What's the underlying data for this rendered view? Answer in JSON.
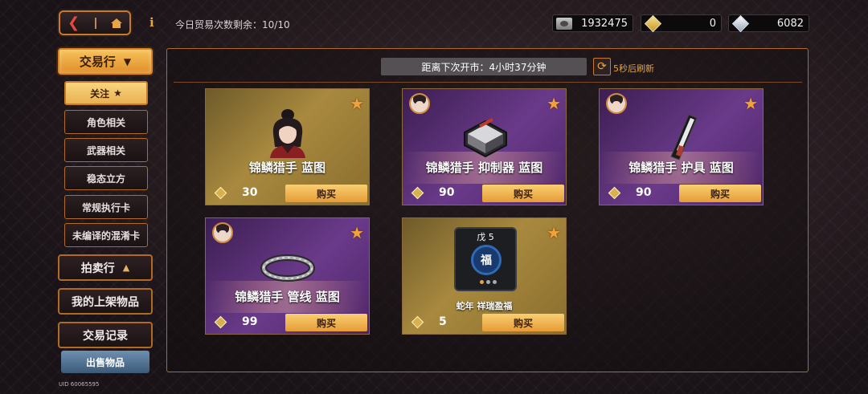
{
  "topbar": {
    "trade_count_label": "今日贸易次数剩余：10/10",
    "currencies": [
      {
        "icon": "cash-icon",
        "value": "1932475"
      },
      {
        "icon": "gold-gem-icon",
        "value": "0"
      },
      {
        "icon": "silver-gem-icon",
        "value": "6082"
      }
    ]
  },
  "sidebar": {
    "main_label": "交易行",
    "subitems": [
      {
        "label": "关注"
      },
      {
        "label": "角色相关"
      },
      {
        "label": "武器相关"
      },
      {
        "label": "稳态立方"
      },
      {
        "label": "常规执行卡"
      },
      {
        "label": "未编译的混淆卡"
      }
    ],
    "auction_label": "拍卖行",
    "my_listings_label": "我的上架物品",
    "trade_records_label": "交易记录",
    "sell_label": "出售物品",
    "uid": "UID 60065595"
  },
  "market": {
    "timer_label": "距离下次开市：4小时37分钟",
    "refresh_label": "5秒后刷新"
  },
  "items": [
    {
      "title": "锦鳞猎手 蓝图",
      "price": "30",
      "buy": "购买",
      "bg": "gold"
    },
    {
      "title": "锦鳞猎手 抑制器 蓝图",
      "price": "90",
      "buy": "购买",
      "bg": "purple"
    },
    {
      "title": "锦鳞猎手 护具 蓝图",
      "price": "90",
      "buy": "购买",
      "bg": "purple"
    },
    {
      "title": "锦鳞猎手 管线 蓝图",
      "price": "99",
      "buy": "购买",
      "bg": "purple"
    },
    {
      "title": "蛇年 祥瑞盈福",
      "price": "5",
      "buy": "购买",
      "bg": "gold",
      "badge": "5",
      "badge_glyph": "戊",
      "emblem": "福"
    }
  ],
  "colors": {
    "accent_orange": "#e8a33a",
    "buy_button": "#f0b450",
    "card_purple": "#6a3a8a",
    "card_gold": "#a8893e"
  }
}
